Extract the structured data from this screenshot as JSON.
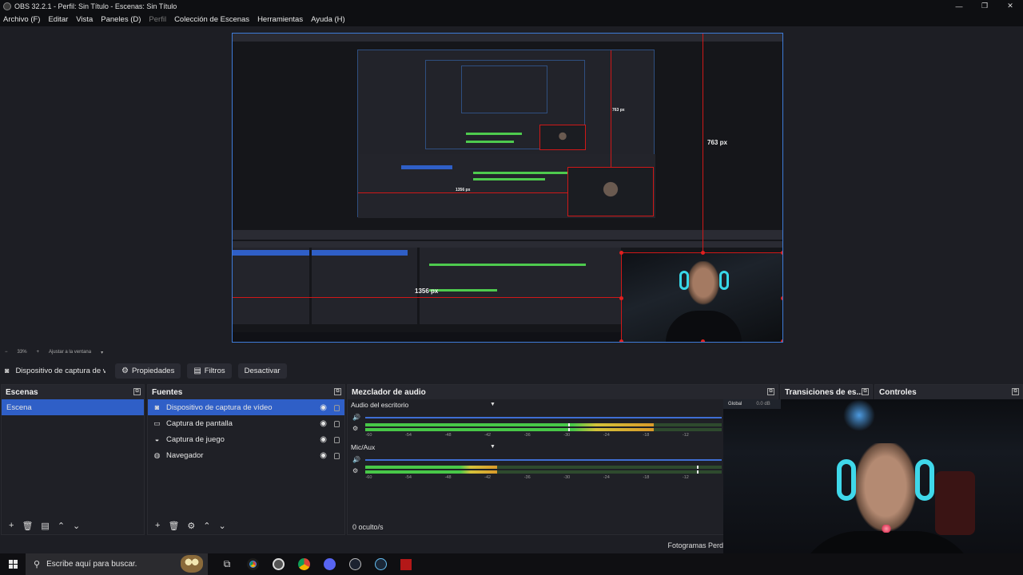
{
  "window": {
    "title": "OBS 32.2.1 - Perfil: Sin Título - Escenas: Sin Título",
    "buttons": [
      "—",
      "❐",
      "✕"
    ]
  },
  "menu": [
    "Archivo (F)",
    "Editar",
    "Vista",
    "Paneles (D)",
    "Perfil",
    "Colección de Escenas",
    "Herramientas",
    "Ayuda (H)"
  ],
  "preview": {
    "measure_vertical": "763 px",
    "measure_horizontal": "1356 px",
    "inner_measure_vertical": "763 px",
    "inner_measure_horizontal": "1356 px"
  },
  "zoom": {
    "level": "33%",
    "fit_label": "Ajustar a la ventana"
  },
  "source_toolbar": {
    "source_name": "Dispositivo de captura de v",
    "properties": "Propiedades",
    "filters": "Filtros",
    "deactivate": "Desactivar"
  },
  "scenes": {
    "title": "Escenas",
    "items": [
      "Escena"
    ]
  },
  "sources": {
    "title": "Fuentes",
    "items": [
      {
        "label": "Dispositivo de captura de vídeo",
        "icon": "camera-icon"
      },
      {
        "label": "Captura de pantalla",
        "icon": "monitor-icon"
      },
      {
        "label": "Captura de juego",
        "icon": "gamepad-icon"
      },
      {
        "label": "Navegador",
        "icon": "globe-icon"
      }
    ]
  },
  "mixer": {
    "title": "Mezclador de audio",
    "channels": [
      {
        "name": "Audio del escritorio",
        "level": 0.81,
        "peak": 0.57,
        "volume": 1.0
      },
      {
        "name": "Mic/Aux",
        "level": 0.37,
        "peak": 0.93,
        "volume": 1.0
      }
    ],
    "ticks": [
      "-60",
      "-54",
      "-48",
      "-42",
      "-36",
      "-30",
      "-24",
      "-18",
      "-12"
    ],
    "hidden": "0 oculto/s"
  },
  "transitions": {
    "title": "Transiciones de es..."
  },
  "controls": {
    "title": "Controles"
  },
  "global": {
    "label": "Global",
    "db": "0.0 dB"
  },
  "status": {
    "frames": "Fotogramas Perd"
  },
  "taskbar": {
    "search_placeholder": "Escribe aquí para buscar.",
    "apps": [
      "task-view-icon",
      "chrome-icon",
      "obs-icon",
      "chrome-icon",
      "discord-icon",
      "steam-shortcut-icon",
      "steam-icon",
      "dota-icon"
    ]
  },
  "colors": {
    "accent": "#2f5fc7",
    "selection_border": "#3e7bd8",
    "guide_red": "#d01818",
    "meter_green": "#48c848",
    "meter_yellow": "#d4c23a"
  }
}
